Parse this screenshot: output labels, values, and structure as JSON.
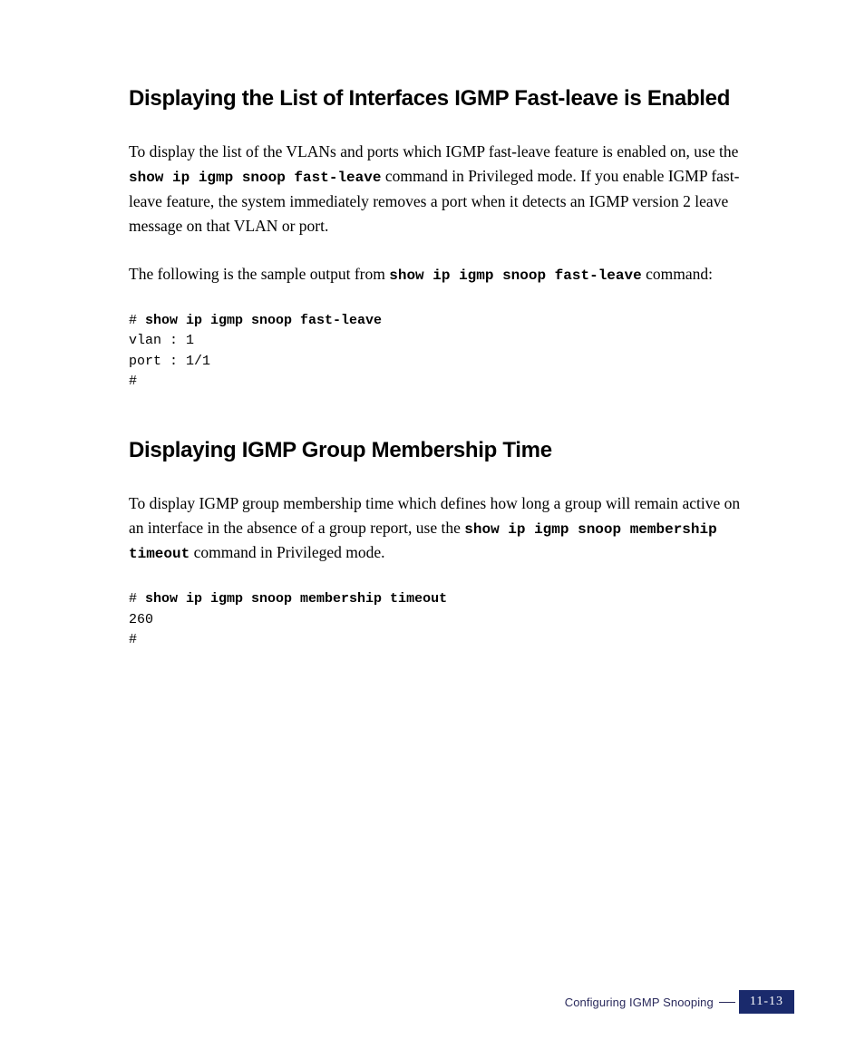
{
  "section1": {
    "heading": "Displaying the List of Interfaces IGMP Fast-leave is Enabled",
    "para1_a": "To display the list of the VLANs and ports which IGMP fast-leave feature is enabled on, use the ",
    "para1_cmd": "show ip igmp snoop fast-leave",
    "para1_b": " command in Privileged mode. If you enable IGMP fast-leave feature, the system immediately removes a port when it detects an IGMP version 2 leave message on that VLAN or port.",
    "para2_a": "The following is the sample output from ",
    "para2_cmd": "show ip igmp snoop fast-leave",
    "para2_b": " command:",
    "code_prompt1": "# ",
    "code_cmd1": "show ip igmp snoop fast-leave",
    "code_line2": "vlan : 1",
    "code_line3": "port : 1/1",
    "code_line4": "#"
  },
  "section2": {
    "heading": "Displaying IGMP Group Membership Time",
    "para1_a": "To display IGMP group membership time which defines how long a group will remain active on an interface in the absence of a group report, use the ",
    "para1_cmd": "show ip igmp snoop membership timeout",
    "para1_b": " command in Privileged mode.",
    "code_prompt1": "# ",
    "code_cmd1": "show ip igmp snoop membership timeout",
    "code_line2": "260",
    "code_line3": "#"
  },
  "footer": {
    "chapter_title": "Configuring IGMP Snooping",
    "page_number": "11-13"
  }
}
